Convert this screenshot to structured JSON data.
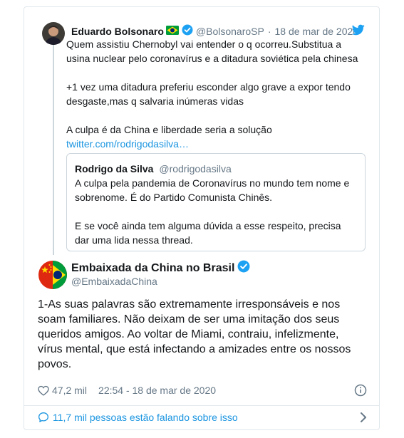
{
  "parent_tweet": {
    "author_name": "Eduardo Bolsonaro",
    "author_handle": "@BolsonaroSP",
    "separator": "·",
    "date": "18 de mar de 2020",
    "text_lines": [
      "Quem assistiu Chernobyl vai entender o q ocorreu.Substitua a",
      "usina nuclear pelo coronavírus e a ditadura soviética pela chinesa",
      "",
      "+1 vez uma ditadura preferiu esconder algo grave a expor tendo",
      "desgaste,mas q salvaria inúmeras vidas",
      "",
      "A culpa é da China e liberdade seria a solução"
    ],
    "link": "twitter.com/rodrigodasilva…",
    "quoted": {
      "author_name": "Rodrigo da Silva",
      "author_handle": "@rodrigodasilva",
      "text_lines": [
        "A culpa pela pandemia de Coronavírus no mundo tem nome e",
        "sobrenome. É do Partido Comunista Chinês.",
        "",
        "E se você ainda tem alguma dúvida a esse respeito, precisa",
        "dar uma lida nessa thread."
      ]
    }
  },
  "main_tweet": {
    "author_name": "Embaixada da China no Brasil",
    "author_handle": "@EmbaixadaChina",
    "text_lines": [
      "1-As suas palavras são extremamente irresponsáveis e nos",
      "soam familiares. Não deixam de ser uma imitação dos seus",
      "queridos amigos. Ao voltar de Miami, contraiu, infelizmente,",
      "vírus mental, que está infectando a amizades entre os nossos",
      "povos."
    ],
    "likes": "47,2 mil",
    "timestamp": "22:54 - 18 de mar de 2020",
    "talking": "11,7 mil pessoas estão falando sobre isso"
  },
  "icons": {
    "verified": "verified-badge-icon",
    "bird": "twitter-bird-icon",
    "heart": "heart-icon",
    "info": "info-icon",
    "comment": "comment-bubble-icon",
    "chevron": "chevron-right-icon",
    "flag": "brazil-flag-emoji"
  },
  "colors": {
    "accent": "#1da1f2",
    "link": "#1b95e0",
    "muted": "#657786",
    "border": "#e1e8ed"
  }
}
